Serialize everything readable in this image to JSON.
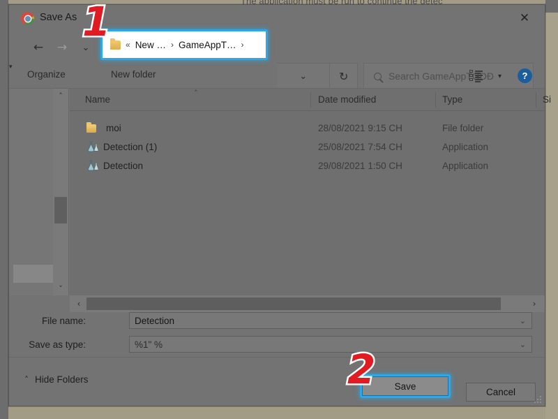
{
  "background": {
    "text": "The application must be run to continue the detec"
  },
  "dialog": {
    "title": "Save As",
    "app_icon": "chrome-icon",
    "close_label": "✕"
  },
  "nav": {
    "back": "←",
    "forward": "→",
    "recent": "⌄",
    "up": "↑",
    "dropdown": "⌄",
    "refresh": "↻"
  },
  "breadcrumb": {
    "folder_icon": "folder-icon",
    "overflow": "«",
    "segments": [
      "New …",
      "GameAppT…"
    ],
    "separator": "›"
  },
  "search": {
    "placeholder": "Search GameAppTGDĐ",
    "icon": "search-icon"
  },
  "toolbar": {
    "organize": "Organize",
    "organize_caret": "▾",
    "new_folder": "New folder",
    "view_caret": "▾",
    "help": "?"
  },
  "file_list": {
    "columns": [
      "Name",
      "Date modified",
      "Type",
      "Si"
    ],
    "sort_indicator": "˄",
    "rows": [
      {
        "icon": "folder-icon",
        "name": "moi",
        "date": "28/08/2021 9:15 CH",
        "type": "File folder"
      },
      {
        "icon": "flask-icon",
        "name": "Detection (1)",
        "date": "25/08/2021 7:54 CH",
        "type": "Application"
      },
      {
        "icon": "flask-icon",
        "name": "Detection",
        "date": "29/08/2021 1:50 CH",
        "type": "Application"
      }
    ]
  },
  "scrollbars": {
    "up_arrow": "˄",
    "down_arrow": "˅",
    "left_arrow": "‹",
    "right_arrow": "›"
  },
  "fields": {
    "file_name_label": "File name:",
    "file_name_value": "Detection",
    "save_type_label": "Save as type:",
    "save_type_value": "%1\" %",
    "caret": "⌄"
  },
  "footer": {
    "hide_folders": "Hide Folders",
    "hide_folders_chevron": "˄",
    "save_label": "Save",
    "cancel_label": "Cancel"
  },
  "annotations": {
    "step_one": "1",
    "step_two": "2"
  },
  "colors": {
    "highlight": "#2aa8e8",
    "accent_red": "#e01b22",
    "dialog_bg": "#737373"
  }
}
